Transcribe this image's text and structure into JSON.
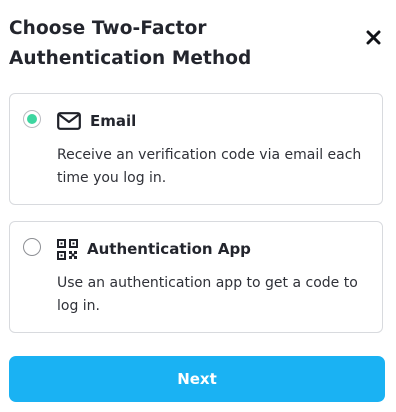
{
  "dialog": {
    "title": "Choose Two-Factor Authentication Method",
    "close_icon": "close-icon"
  },
  "options": [
    {
      "id": "email",
      "selected": true,
      "icon": "envelope-icon",
      "label": "Email",
      "description": "Receive an verification code via email each time you log in."
    },
    {
      "id": "app",
      "selected": false,
      "icon": "qr-code-icon",
      "label": "Authentication App",
      "description": "Use an authentication app to get a code to log in."
    }
  ],
  "actions": {
    "next_label": "Next"
  },
  "colors": {
    "accent": "#1ab2f3",
    "radio_selected": "#3dd6a0",
    "border": "#d8dade"
  }
}
